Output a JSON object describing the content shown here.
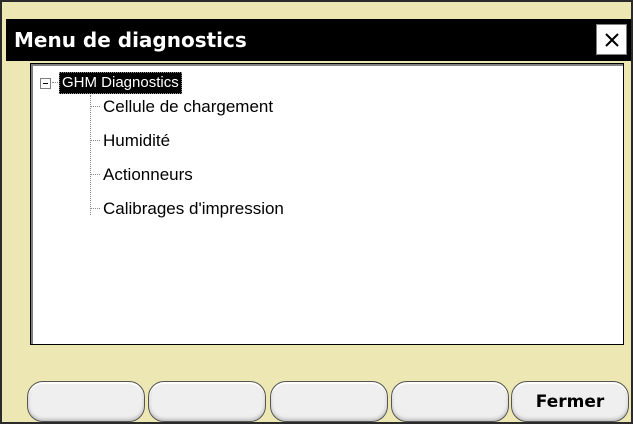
{
  "window": {
    "title": "Menu de diagnostics",
    "close_icon": "close-icon"
  },
  "tree": {
    "root": {
      "label": "GHM Diagnostics",
      "expanded": true,
      "selected": true,
      "children": [
        {
          "label": "Cellule de chargement"
        },
        {
          "label": "Humidité"
        },
        {
          "label": "Actionneurs"
        },
        {
          "label": "Calibrages d'impression"
        }
      ]
    }
  },
  "bottom_buttons": [
    {
      "label": ""
    },
    {
      "label": ""
    },
    {
      "label": ""
    },
    {
      "label": ""
    },
    {
      "label": "Fermer"
    }
  ],
  "colors": {
    "dialog_background": "#ece7b3",
    "titlebar": "#000000",
    "selection": "#000000"
  }
}
